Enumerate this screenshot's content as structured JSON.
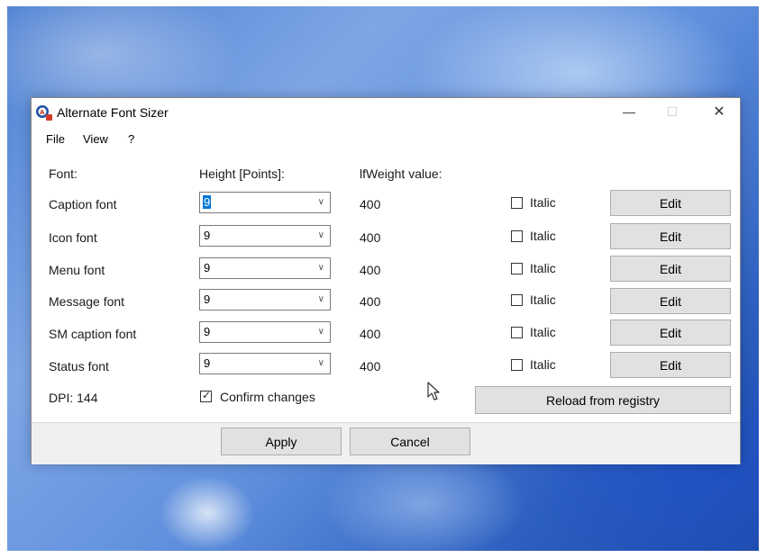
{
  "window": {
    "title": "Alternate Font Sizer",
    "controls": {
      "minimize": "—",
      "maximize": "☐",
      "close": "✕"
    }
  },
  "menu": [
    "File",
    "View",
    "?"
  ],
  "headers": {
    "font": "Font:",
    "height": "Height [Points]:",
    "weight": "lfWeight value:"
  },
  "rows": [
    {
      "label": "Caption font",
      "height": "9",
      "weight": "400",
      "italic_label": "Italic",
      "italic_checked": false,
      "edit_label": "Edit"
    },
    {
      "label": "Icon font",
      "height": "9",
      "weight": "400",
      "italic_label": "Italic",
      "italic_checked": false,
      "edit_label": "Edit"
    },
    {
      "label": "Menu font",
      "height": "9",
      "weight": "400",
      "italic_label": "Italic",
      "italic_checked": false,
      "edit_label": "Edit"
    },
    {
      "label": "Message font",
      "height": "9",
      "weight": "400",
      "italic_label": "Italic",
      "italic_checked": false,
      "edit_label": "Edit"
    },
    {
      "label": "SM caption font",
      "height": "9",
      "weight": "400",
      "italic_label": "Italic",
      "italic_checked": false,
      "edit_label": "Edit"
    },
    {
      "label": "Status font",
      "height": "9",
      "weight": "400",
      "italic_label": "Italic",
      "italic_checked": false,
      "edit_label": "Edit"
    }
  ],
  "dpi": "DPI: 144",
  "confirm_changes": {
    "label": "Confirm changes",
    "checked": true
  },
  "reload_label": "Reload from registry",
  "apply_label": "Apply",
  "cancel_label": "Cancel",
  "icons": {
    "app": "app-icon",
    "dropdown": "chevron-down-icon",
    "check": "checkmark-icon",
    "cursor": "mouse-pointer-icon"
  },
  "colors": {
    "selection": "#0078d7",
    "button_face": "#e1e1e1",
    "dialog_bg": "#f0f0f0"
  }
}
